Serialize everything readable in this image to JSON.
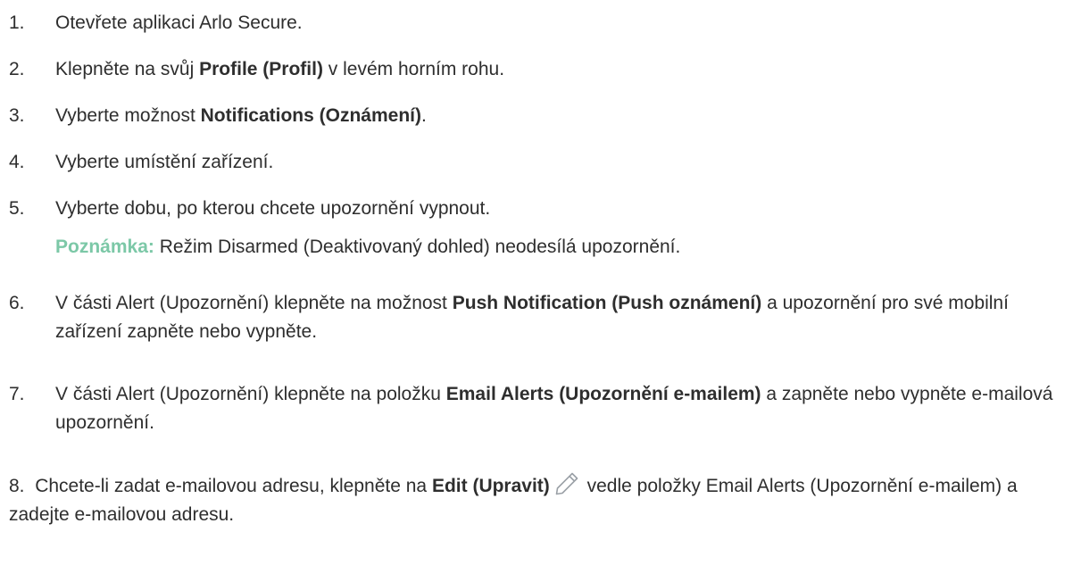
{
  "steps": [
    {
      "num": "1.",
      "text": "Otevřete aplikaci Arlo Secure."
    },
    {
      "num": "2.",
      "pre": "Klepněte na svůj ",
      "bold": "Profile (Profil)",
      "post": " v levém horním rohu."
    },
    {
      "num": "3.",
      "pre": "Vyberte možnost ",
      "bold": "Notifications (Oznámení)",
      "post": "."
    },
    {
      "num": "4.",
      "text": "Vyberte umístění zařízení."
    },
    {
      "num": "5.",
      "text": "Vyberte dobu, po kterou chcete upozornění vypnout.",
      "note_label": "Poznámka:",
      "note_text": " Režim Disarmed (Deaktivovaný dohled) neodesílá upozornění."
    },
    {
      "num": "6.",
      "pre": "V části Alert (Upozornění) klepněte na možnost ",
      "bold": "Push Notification (Push oznámení)",
      "post": " a upozornění pro své mobilní zařízení zapněte nebo vypněte."
    },
    {
      "num": "7.",
      "pre": "V části Alert (Upozornění) klepněte na položku ",
      "bold": "Email Alerts (Upozornění e-mailem)",
      "post": " a zapněte nebo vypněte e-mailová upozornění."
    },
    {
      "num": "8.",
      "pre": "Chcete-li zadat e-mailovou adresu, klepněte na ",
      "bold": "Edit (Upravit)",
      "icon": "pencil-icon",
      "post": " vedle položky Email Alerts (Upozornění e-mailem) a zadejte e-mailovou adresu."
    }
  ],
  "colors": {
    "text": "#2e2e2e",
    "note_label": "#7cc8a7",
    "icon": "#9aa0a6"
  }
}
